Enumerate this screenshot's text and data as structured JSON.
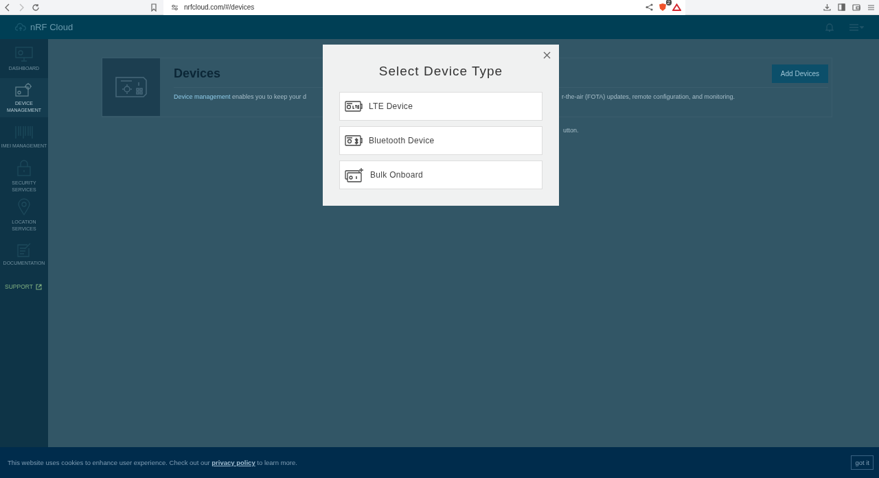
{
  "browser": {
    "url": "nrfcloud.com/#/devices",
    "shield_badge": "2"
  },
  "app_header": {
    "brand": "nRF Cloud"
  },
  "sidebar": {
    "items": [
      {
        "label": "DASHBOARD",
        "kind": "monitor",
        "selected": false
      },
      {
        "label": "DEVICE MANAGEMENT",
        "kind": "device",
        "selected": true
      },
      {
        "label": "IMEI MANAGEMENT",
        "kind": "barcode",
        "selected": false
      },
      {
        "label": "SECURITY SERVICES",
        "kind": "lock",
        "selected": false
      },
      {
        "label": "LOCATION SERVICES",
        "kind": "pin",
        "selected": false
      },
      {
        "label": "DOCUMENTATION",
        "kind": "doc",
        "selected": false
      }
    ],
    "support": "SUPPORT"
  },
  "page": {
    "title": "Devices",
    "add_button": "Add Devices",
    "description_link": "Device management",
    "description_visible_start": " enables you to keep your d",
    "description_visible_end": "r-the-air (FOTA) updates, remote configuration, and monitoring.",
    "note_fragment": "utton."
  },
  "modal": {
    "title": "Select Device Type",
    "options": [
      {
        "label": "LTE Device",
        "kind": "lte"
      },
      {
        "label": "Bluetooth Device",
        "kind": "bluetooth"
      },
      {
        "label": "Bulk Onboard",
        "kind": "bulk"
      }
    ]
  },
  "cookie_banner": {
    "text_before": "This website uses cookies to enhance user experience. Check out our ",
    "link": "privacy policy",
    "text_after": " to learn more.",
    "button": "got it"
  }
}
